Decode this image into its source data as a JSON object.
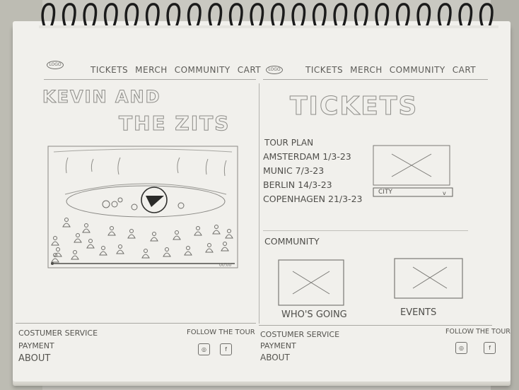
{
  "site_a": {
    "logo": "LOGO",
    "nav": [
      "TICKETS",
      "MERCH",
      "COMMUNITY",
      "CART"
    ],
    "band_title_line1": "KEVIN AND",
    "band_title_line2": "THE ZITS",
    "footer": {
      "links": [
        "COSTUMER SERVICE",
        "PAYMENT",
        "ABOUT"
      ],
      "follow": "FOLLOW THE TOUR",
      "social_icons": [
        "instagram-icon",
        "facebook-icon"
      ]
    }
  },
  "site_b": {
    "logo": "LOGO",
    "nav": [
      "TICKETS",
      "MERCH",
      "COMMUNITY",
      "CART"
    ],
    "page_title": "TICKETS",
    "tour_heading": "TOUR PLAN",
    "tour_dates": [
      "AMSTERDAM 1/3-23",
      "MUNIC 7/3-23",
      "BERLIN 14/3-23",
      "COPENHAGEN 21/3-23"
    ],
    "city_select": "CITY",
    "community_heading": "COMMUNITY",
    "community_cards": [
      "WHO'S GOING",
      "EVENTS"
    ],
    "footer": {
      "links": [
        "COSTUMER SERVICE",
        "PAYMENT",
        "ABOUT"
      ],
      "follow": "FOLLOW THE TOUR",
      "social_icons": [
        "instagram-icon",
        "facebook-icon"
      ]
    }
  },
  "video": {
    "time": "00:00"
  }
}
